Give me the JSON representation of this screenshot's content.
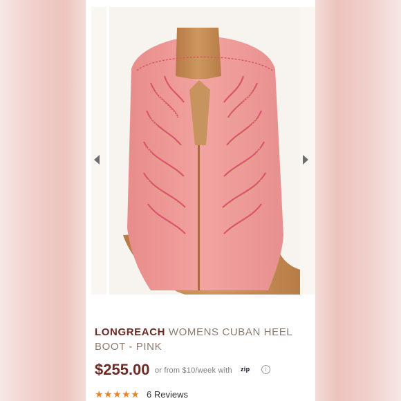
{
  "product": {
    "brand": "LONGREACH",
    "title": "WOMENS CUBAN HEEL BOOT - PINK",
    "price": "$255.00",
    "installment_text": "or from $10/week with",
    "installment_provider": "zip",
    "info_icon": "ⓘ",
    "rating": 5,
    "stars": "★★★★★",
    "reviews": "6 Reviews"
  },
  "gallery": {
    "prev_icon": "chevron-left-icon",
    "next_icon": "chevron-right-icon"
  },
  "colors": {
    "brand": "#6b2b24",
    "boot_pink": "#ee9a98",
    "stitch_pink": "#d9566a",
    "tan_leather": "#c48b52",
    "star": "#e98426"
  }
}
